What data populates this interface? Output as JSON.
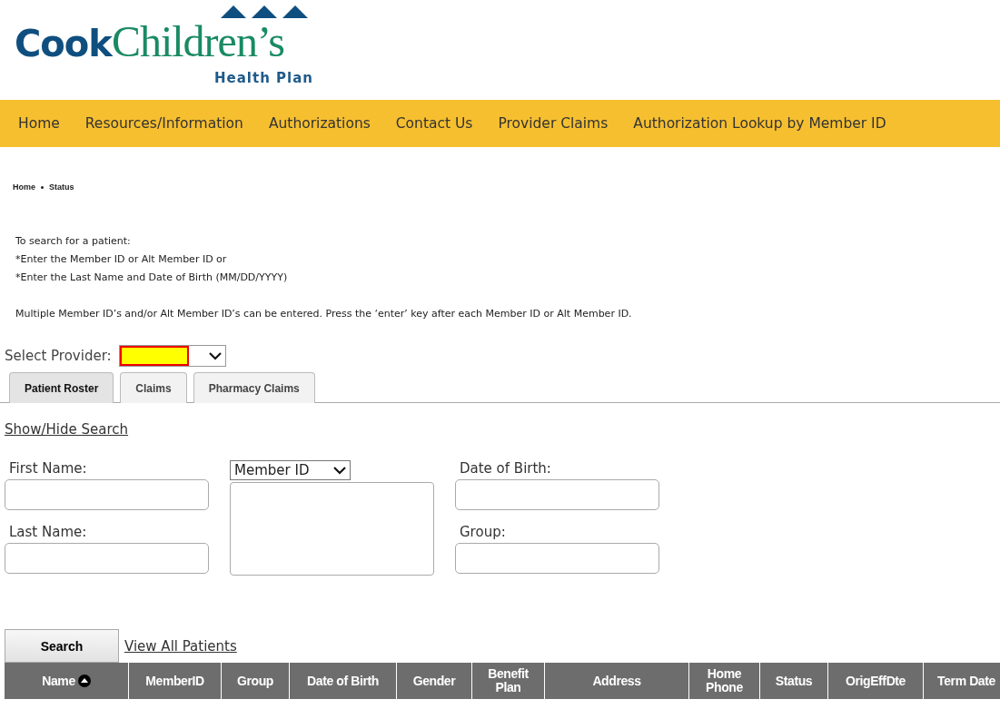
{
  "logo": {
    "brand_first": "Cook",
    "brand_second": "Children’s",
    "subtitle": "Health Plan"
  },
  "nav": [
    {
      "label": "Home"
    },
    {
      "label": "Resources/Information"
    },
    {
      "label": "Authorizations"
    },
    {
      "label": "Contact Us"
    },
    {
      "label": "Provider Claims"
    },
    {
      "label": "Authorization Lookup by Member ID"
    }
  ],
  "breadcrumb": [
    "Home",
    "Status"
  ],
  "instructions": [
    "To search for a patient:",
    "*Enter the Member ID or Alt Member ID or",
    "*Enter the Last Name and Date of Birth (MM/DD/YYYY)"
  ],
  "note": "Multiple Member ID’s and/or Alt Member ID’s can be entered. Press the ‘enter’ key after each Member ID or Alt Member ID.",
  "provider": {
    "label": "Select Provider:",
    "highlighted": true
  },
  "tabs": [
    {
      "label": "Patient Roster",
      "selected": true
    },
    {
      "label": "Claims",
      "selected": false
    },
    {
      "label": "Pharmacy Claims",
      "selected": false
    }
  ],
  "toggle_link": "Show/Hide Search",
  "form": {
    "first_name": "First Name:",
    "last_name": "Last Name:",
    "id_type": "Member ID",
    "date_of_birth": "Date of Birth:",
    "group": "Group:"
  },
  "search_button": "Search",
  "view_all_link": "View All Patients",
  "table": {
    "columns": [
      {
        "label": "Name",
        "sorted": true
      },
      {
        "label": "MemberID",
        "sorted": false
      },
      {
        "label": "Group",
        "sorted": false
      },
      {
        "label": "Date of Birth",
        "sorted": false
      },
      {
        "label": "Gender",
        "sorted": false
      },
      {
        "label": "Benefit Plan",
        "sorted": false
      },
      {
        "label": "Address",
        "sorted": false
      },
      {
        "label": "Home Phone",
        "sorted": false
      },
      {
        "label": "Status",
        "sorted": false
      },
      {
        "label": "OrigEffDte",
        "sorted": false
      },
      {
        "label": "Term Date",
        "sorted": false
      }
    ]
  }
}
